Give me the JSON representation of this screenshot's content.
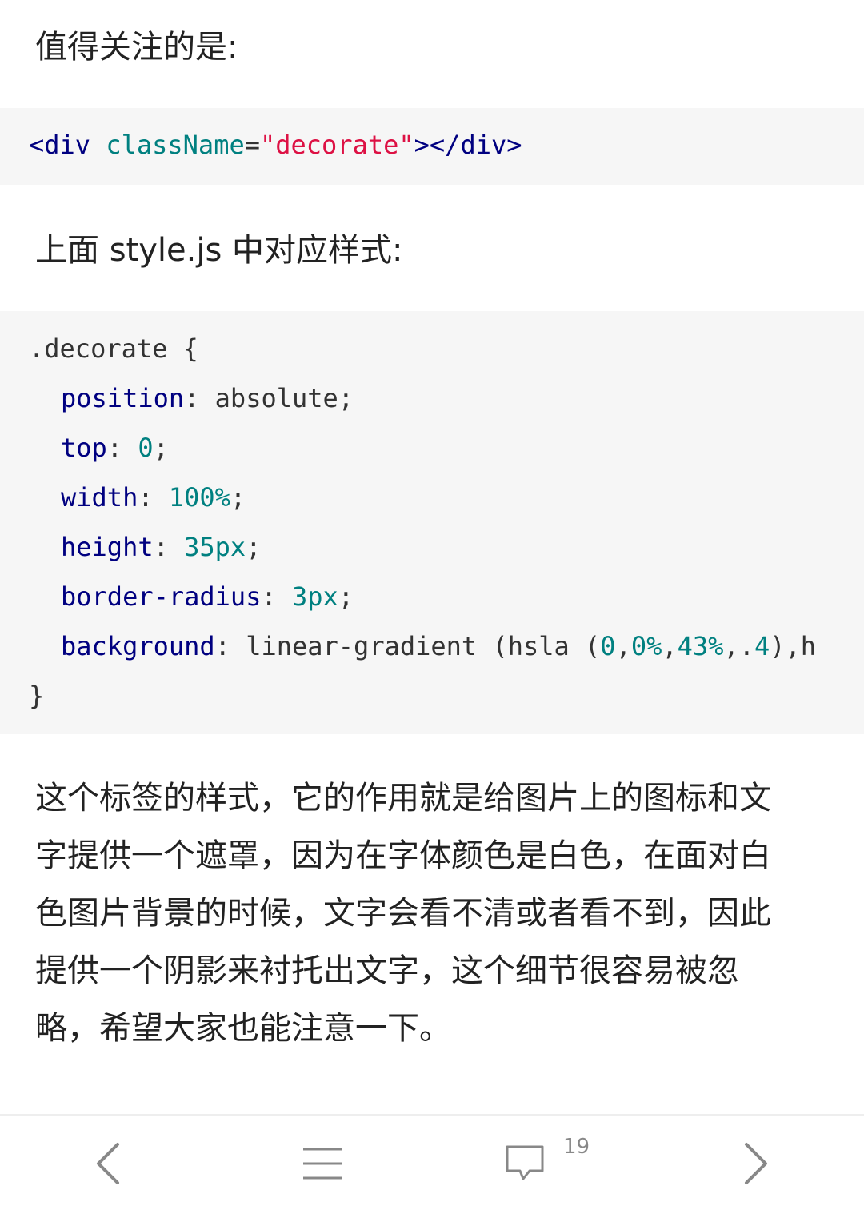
{
  "article": {
    "heading_1": "值得关注的是:",
    "code_1": {
      "open_tag": "<div",
      "attr_name": "className",
      "equals": "=",
      "attr_value": "\"decorate\"",
      "close_tag": "></div>"
    },
    "heading_2": "上面 style.js 中对应样式:",
    "code_2": {
      "selector": ".decorate {",
      "lines": [
        {
          "prop": "position",
          "sep": ": ",
          "value": "absolute",
          "value_type": "plain",
          "end": ";"
        },
        {
          "prop": "top",
          "sep": ": ",
          "value": "0",
          "value_type": "num",
          "end": ";"
        },
        {
          "prop": "width",
          "sep": ": ",
          "value": "100%",
          "value_type": "num",
          "end": ";"
        },
        {
          "prop": "height",
          "sep": ": ",
          "value": "35px",
          "value_type": "num",
          "end": ";"
        },
        {
          "prop": "border-radius",
          "sep": ": ",
          "value": "3px",
          "value_type": "num",
          "end": ";"
        }
      ],
      "background_line": {
        "prop": "background",
        "sep": ": ",
        "text_a": "linear-gradient (hsla (",
        "n1": "0",
        "comma1": ",",
        "n2": "0%",
        "comma2": ",",
        "n3": "43%",
        "comma3": ",.",
        "n4": "4",
        "tail": "),h"
      },
      "closing": "}"
    },
    "body_lines": [
      "这个标签的样式，它的作用就是给图片上的图标和文",
      "字提供一个遮罩，因为在字体颜色是白色，在面对白",
      "色图片背景的时候，文字会看不清或者看不到，因此",
      "提供一个阴影来衬托出文字，这个细节很容易被忽",
      "略，希望大家也能注意一下。"
    ]
  },
  "bottom_bar": {
    "comment_count": "19"
  },
  "icons": {
    "back": "chevron-left-icon",
    "menu": "menu-icon",
    "comments": "comment-icon",
    "forward": "chevron-right-icon"
  },
  "colors": {
    "code_background": "#f6f6f6",
    "code_tag": "#000080",
    "code_attr": "#008080",
    "code_string": "#dd1144",
    "icon_gray": "#888888"
  }
}
